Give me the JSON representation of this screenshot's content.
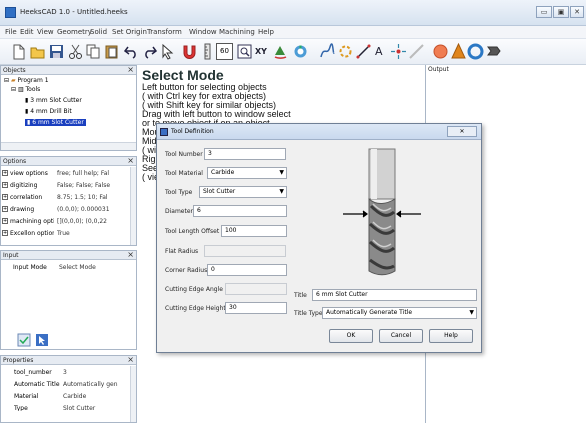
{
  "window": {
    "title": "HeeksCAD 1.0 - Untitled.heeks",
    "minimize": "▭",
    "maximize": "▣",
    "close": "✕"
  },
  "menu": [
    "File",
    "Edit",
    "View",
    "Geometry",
    "Solid",
    "Set Origin",
    "Transform",
    "Window",
    "Machining",
    "Help"
  ],
  "toolbar": {
    "icons": [
      "new-file-icon",
      "open-folder-icon",
      "save-icon",
      "cut-icon",
      "copy-icon",
      "paste-icon",
      "undo-icon",
      "redo-icon",
      "select-icon",
      "magnet-icon",
      "ruler-icon",
      "grid-60-icon",
      "view-fit-icon",
      "xy-plane-icon",
      "view-rotate-icon",
      "view-spin-icon",
      "sketch-icon",
      "spline-icon",
      "line-icon",
      "text-icon",
      "point-icon",
      "arc-icon",
      "circle-icon",
      "cone-icon",
      "cylinder-icon",
      "torus-icon"
    ],
    "grid_label": "60",
    "xy_label": "XY",
    "text_label": "A"
  },
  "objects": {
    "title": "Objects",
    "tree": [
      "Program 1",
      "Tools",
      "3 mm Slot Cutter",
      "4 mm Drill Bit",
      "6 mm Slot Cutter"
    ]
  },
  "options": {
    "title": "Options",
    "rows": [
      {
        "key": "view options",
        "value": "free; full help; Fal"
      },
      {
        "key": "digitizing",
        "value": "False; False; False"
      },
      {
        "key": "correlation",
        "value": "8.75; 1.5; 10; Fal"
      },
      {
        "key": "drawing",
        "value": "(0.0,0); 0.000031"
      },
      {
        "key": "machining optic",
        "value": "[](0,0,0); (0,0,22"
      },
      {
        "key": "Excellon option",
        "value": "True"
      }
    ]
  },
  "input": {
    "title": "Input",
    "key": "Input Mode",
    "value": "Select Mode"
  },
  "properties": {
    "title": "Properties",
    "rows": [
      {
        "key": "tool_number",
        "value": "3"
      },
      {
        "key": "Automatic Title",
        "value": "Automatically gen"
      },
      {
        "key": "Material",
        "value": "Carbide"
      },
      {
        "key": "Type",
        "value": "Slot Cutter"
      }
    ]
  },
  "canvas": {
    "mode_title": "Select Mode",
    "hints": [
      "Left button for selecting objects",
      "( with Ctrl key for extra objects)",
      "( with Shift key for similar objects)",
      "Drag with left button to window select",
      "or to move object if on an object",
      "Mou",
      "Midd",
      "( wit",
      "Righ",
      "See",
      "( vie"
    ]
  },
  "output": {
    "title": "Output"
  },
  "dialog": {
    "title": "Tool Definition",
    "close": "✕",
    "fields": [
      {
        "label": "Tool Number",
        "value": "3",
        "kind": "text"
      },
      {
        "label": "Tool Material",
        "value": "Carbide",
        "kind": "combo"
      },
      {
        "label": "Tool Type",
        "value": "Slot Cutter",
        "kind": "combo"
      },
      {
        "label": "Diameter",
        "value": "6",
        "kind": "text"
      },
      {
        "label": "Tool Length Offset",
        "value": "100",
        "kind": "text"
      },
      {
        "label": "Flat Radius",
        "value": "",
        "kind": "disabled"
      },
      {
        "label": "Corner Radius",
        "value": "0",
        "kind": "text"
      },
      {
        "label": "Cutting Edge Angle",
        "value": "",
        "kind": "disabled"
      },
      {
        "label": "Cutting Edge Height",
        "value": "30",
        "kind": "text"
      }
    ],
    "title_label": "Title",
    "title_value": "6 mm Slot Cutter",
    "title_type_label": "Title Type",
    "title_type_value": "Automatically Generate Title",
    "ok": "OK",
    "cancel": "Cancel",
    "help": "Help"
  }
}
